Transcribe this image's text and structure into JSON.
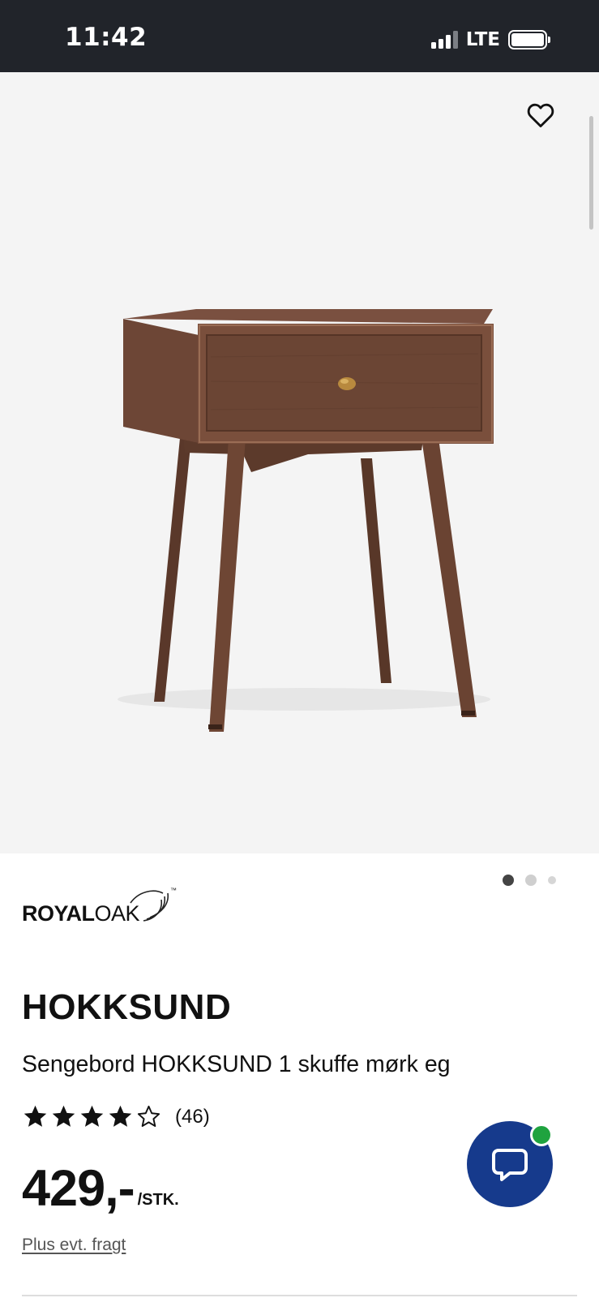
{
  "status_bar": {
    "time": "11:42",
    "network": "LTE",
    "signal_bars_active": 3,
    "signal_bars_total": 4,
    "battery_icon": "battery-full-icon"
  },
  "gallery": {
    "favorite_icon": "heart-outline-icon",
    "image_alt": "Sengebord HOKKSUND 1 skuffe mørk eg",
    "dots_total": 3,
    "active_dot": 1
  },
  "brand": {
    "name_bold": "ROYAL",
    "name_light": "OAK",
    "trademark": "™"
  },
  "product": {
    "name": "HOKKSUND",
    "description": "Sengebord HOKKSUND 1 skuffe mørk eg",
    "rating_stars": 4,
    "rating_max": 5,
    "rating_count": "(46)",
    "price": "429,-",
    "price_unit": "/STK.",
    "freight_note": "Plus evt. fragt"
  },
  "chat": {
    "icon": "chat-bubble-icon",
    "status": "online"
  },
  "colors": {
    "status_bar_bg": "#21242a",
    "gallery_bg": "#f4f4f4",
    "chat_bg": "#163a8c",
    "online_green": "#1fa33f",
    "wood_dark": "#6b4534"
  }
}
